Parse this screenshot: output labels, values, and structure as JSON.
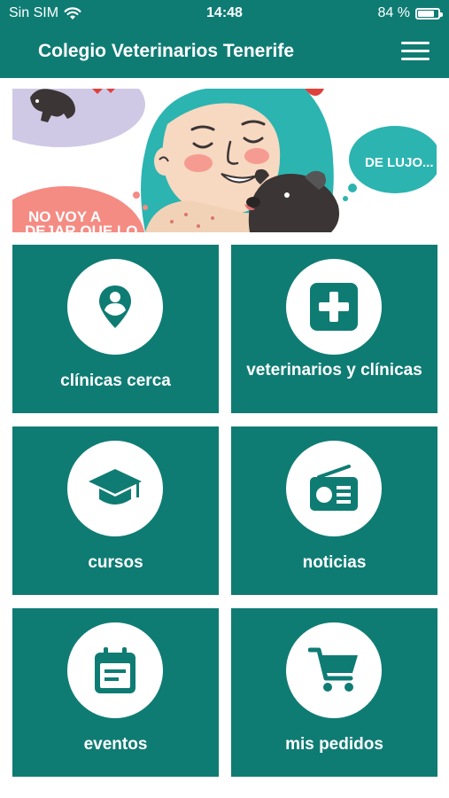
{
  "status": {
    "carrier": "Sin SIM",
    "time": "14:48",
    "battery": "84 %",
    "battery_level": 0.84
  },
  "header": {
    "title": "Colegio Veterinarios Tenerife",
    "menu_icon": "hamburger-menu-icon"
  },
  "banner": {
    "bubble_right": "DE LUJO...",
    "bubble_left_line1": "NO VOY A",
    "bubble_left_line2": "DEJAR QUE LO"
  },
  "tiles": [
    {
      "label": "clínicas cerca",
      "icon": "location-pin-icon"
    },
    {
      "label": "veterinarios y clínicas",
      "icon": "medical-cross-icon"
    },
    {
      "label": "cursos",
      "icon": "graduation-cap-icon"
    },
    {
      "label": "noticias",
      "icon": "radio-icon"
    },
    {
      "label": "eventos",
      "icon": "calendar-icon"
    },
    {
      "label": "mis pedidos",
      "icon": "shopping-cart-icon"
    }
  ],
  "colors": {
    "primary": "#0f7c74",
    "tile_icon": "#0f7c74",
    "white": "#ffffff"
  }
}
